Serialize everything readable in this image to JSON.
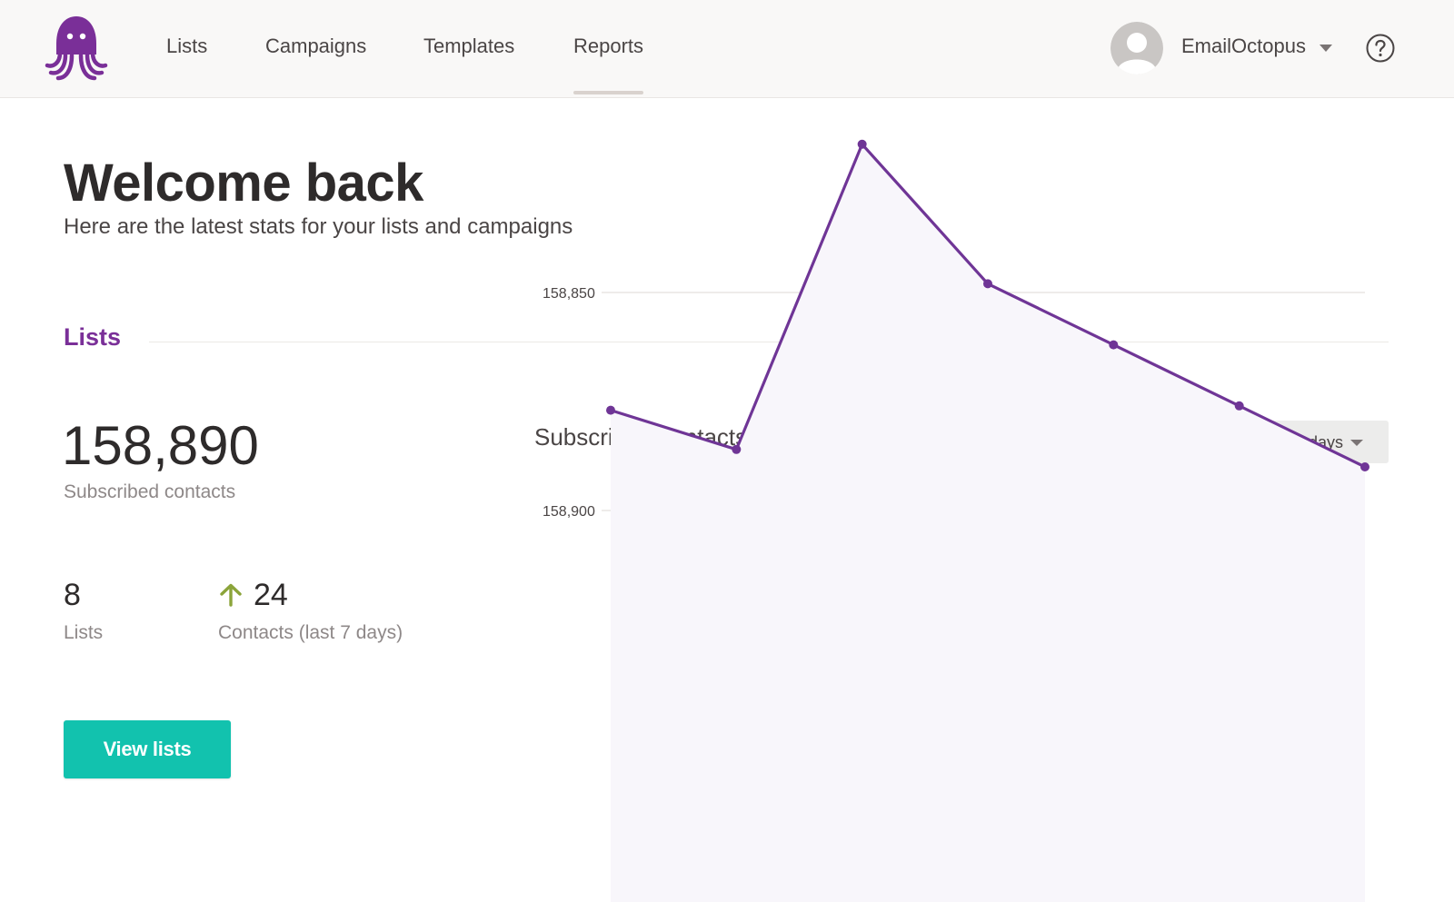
{
  "header": {
    "nav": [
      {
        "label": "Lists",
        "active": false
      },
      {
        "label": "Campaigns",
        "active": false
      },
      {
        "label": "Templates",
        "active": false
      },
      {
        "label": "Reports",
        "active": true
      }
    ],
    "account_name": "EmailOctopus",
    "icons": [
      "octopus-logo",
      "user-avatar",
      "chevron-down-icon",
      "help-icon"
    ]
  },
  "welcome": {
    "title": "Welcome back",
    "subtitle": "Here are the latest stats for your lists and campaigns"
  },
  "lists_section": {
    "title": "Lists",
    "subscribed_count": "158,890",
    "subscribed_label": "Subscribed contacts",
    "lists_count": "8",
    "lists_label": "Lists",
    "contacts_change": "24",
    "contacts_change_label": "Contacts (last 7 days)",
    "contacts_change_direction": "up",
    "view_lists_button": "View lists"
  },
  "range_select": {
    "selected": "Last 7 days"
  },
  "colors": {
    "brand": "#7a2f98",
    "accent": "#12c2ae",
    "up_arrow": "#8ba43a",
    "line": "#6f3596",
    "area": "#f8f6fb"
  },
  "chart_data": {
    "type": "area",
    "title": "Subscribed contacts over time",
    "xlabel": "",
    "ylabel": "",
    "y_ticks": [
      158850,
      158900
    ],
    "y_tick_labels": [
      "158,850",
      "158,900"
    ],
    "ylim": [
      158810,
      158900
    ],
    "grid": true,
    "series": [
      {
        "values": [
          158877,
          158886,
          158816,
          158848,
          158862,
          158876,
          158890
        ]
      }
    ]
  }
}
